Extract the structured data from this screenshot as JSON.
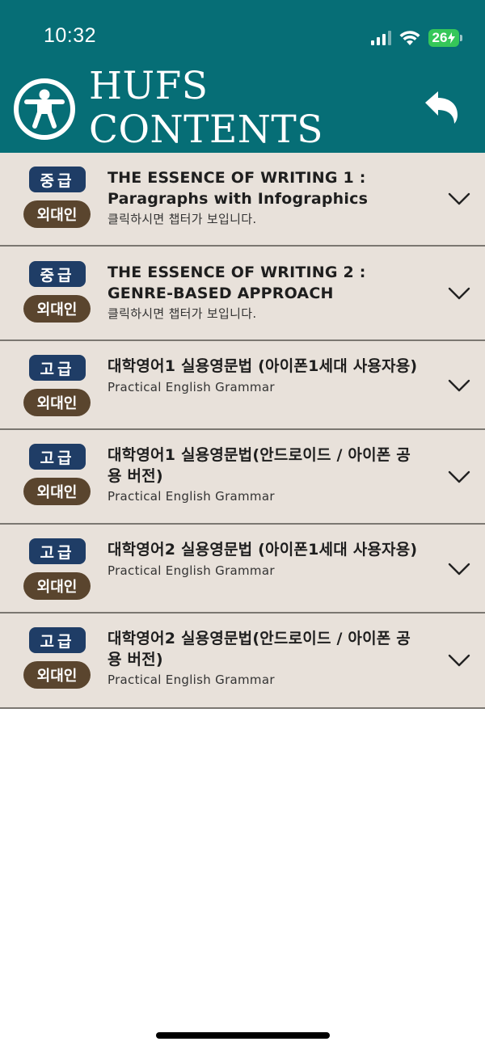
{
  "status_bar": {
    "time": "10:32",
    "battery": "26"
  },
  "header": {
    "title_line1": "HUFS",
    "title_line2": "CONTENTS"
  },
  "courses": [
    {
      "level": "중급",
      "audience": "외대인",
      "title": "THE ESSENCE OF WRITING 1 : Paragraphs with Infographics",
      "subtitle": "클릭하시면 챕터가 보입니다."
    },
    {
      "level": "중급",
      "audience": "외대인",
      "title": "THE ESSENCE OF WRITING 2 : GENRE-BASED APPROACH",
      "subtitle": "클릭하시면 챕터가 보입니다."
    },
    {
      "level": "고급",
      "audience": "외대인",
      "title": "대학영어1 실용영문법 (아이폰1세대 사용자용)",
      "subtitle": "Practical English Grammar"
    },
    {
      "level": "고급",
      "audience": "외대인",
      "title": "대학영어1 실용영문법(안드로이드 / 아이폰 공용 버전)",
      "subtitle": "Practical English Grammar"
    },
    {
      "level": "고급",
      "audience": "외대인",
      "title": "대학영어2 실용영문법 (아이폰1세대 사용자용)",
      "subtitle": "Practical English Grammar"
    },
    {
      "level": "고급",
      "audience": "외대인",
      "title": "대학영어2 실용영문법(안드로이드 / 아이폰 공용 버전)",
      "subtitle": "Practical English Grammar"
    }
  ],
  "colors": {
    "header_bg": "#066e76",
    "row_bg": "#e8e1da",
    "level_badge": "#1f3d66",
    "audience_badge": "#5a452e",
    "battery": "#35c759"
  }
}
